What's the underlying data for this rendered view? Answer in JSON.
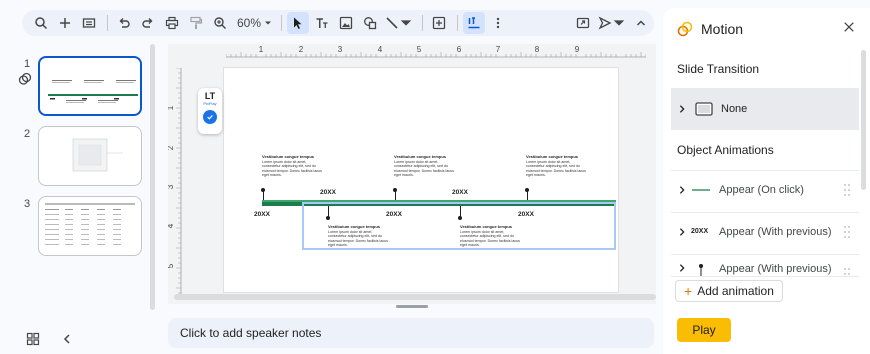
{
  "toolbar": {
    "zoom_value": "60%"
  },
  "filmstrip": {
    "slides": [
      {
        "number": "1"
      },
      {
        "number": "2"
      },
      {
        "number": "3"
      }
    ]
  },
  "rulers": {
    "horizontal_ticks": [
      "1",
      "2",
      "3",
      "4",
      "5",
      "6",
      "7",
      "8",
      "9"
    ],
    "vertical_ticks": [
      "1",
      "2",
      "3",
      "4",
      "5"
    ]
  },
  "widget": {
    "logo": "LT",
    "sub": "PixPlay"
  },
  "slide": {
    "top_items": [
      {
        "title": "Vestibulum congue tempus",
        "body": "Lorem ipsum dolor sit amet, consectetur adipiscing elit, sed do eiusmod tempor. Donec facilisis lacus eget mauris."
      },
      {
        "title": "Vestibulum congue tempus",
        "body": "Lorem ipsum dolor sit amet, consectetur adipiscing elit, sed do eiusmod tempor. Donec facilisis lacus eget mauris."
      },
      {
        "title": "Vestibulum congue tempus",
        "body": "Lorem ipsum dolor sit amet, consectetur adipiscing elit, sed do eiusmod tempor. Donec facilisis lacus eget mauris."
      }
    ],
    "bottom_items": [
      {
        "title": "Vestibulum congue tempus",
        "body": "Lorem ipsum dolor sit amet, consectetur adipiscing elit, sed do eiusmod tempor. Donec facilisis lacus eget mauris."
      },
      {
        "title": "Vestibulum congue tempus",
        "body": "Lorem ipsum dolor sit amet, consectetur adipiscing elit, sed do eiusmod tempor. Donec facilisis lacus eget mauris."
      }
    ],
    "labels": [
      "20XX",
      "20XX",
      "20XX",
      "20XX",
      "20XX"
    ]
  },
  "notes": {
    "placeholder": "Click to add speaker notes"
  },
  "motion_panel": {
    "title": "Motion",
    "slide_transition_heading": "Slide Transition",
    "transition_value": "None",
    "object_animations_heading": "Object Animations",
    "animations": [
      {
        "icon_text": "",
        "label": "Appear  (On click)"
      },
      {
        "icon_text": "20XX",
        "label": "Appear  (With previous)"
      },
      {
        "icon_text": "",
        "label": "Appear  (With previous)"
      }
    ],
    "add_animation_label": "Add animation",
    "play_label": "Play"
  },
  "colors": {
    "accent_blue": "#0b57d0",
    "timeline_green": "#1e7b4b",
    "play_yellow": "#fbbc04",
    "motion_orange": "#e37400"
  }
}
